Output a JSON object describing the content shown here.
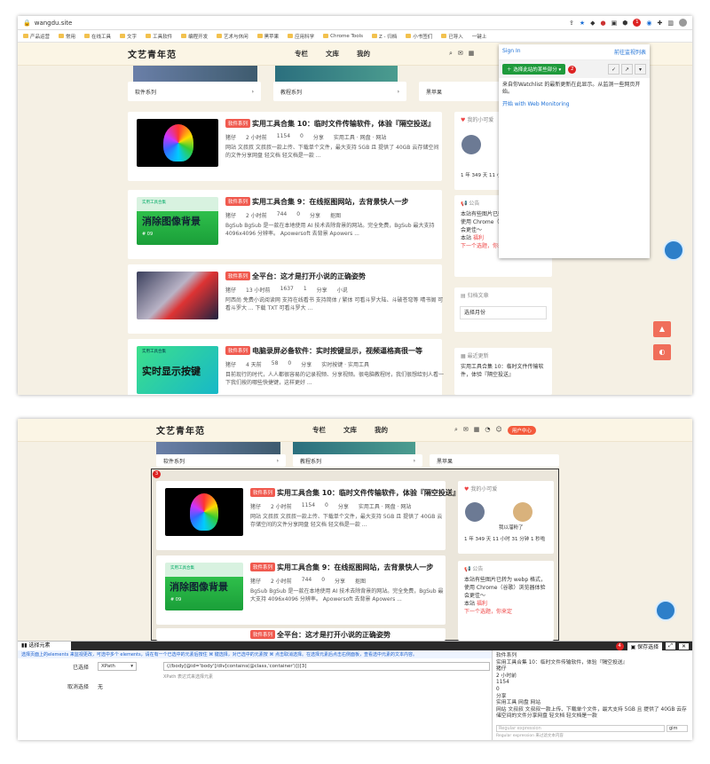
{
  "browser": {
    "url": "wangdu.site",
    "bookmarks": [
      "产品运营",
      "常用",
      "在线工具",
      "文字",
      "工具软件",
      "编程开发",
      "艺术与休闲",
      "黑苹果",
      "应用科学",
      "Chrome Tools",
      "Z - 归档",
      "小书签们",
      "已导入",
      "一键上",
      "其他书"
    ]
  },
  "site": {
    "logo": "文艺青年范",
    "nav": [
      "专栏",
      "文库",
      "我的"
    ],
    "user_center": "用户中心",
    "categories": [
      "软件系列",
      "教程系列",
      "黑苹果"
    ],
    "posts": [
      {
        "badge": "软件系列",
        "title": "实用工具合集 10：临时文件传输软件，体验『隔空投送』",
        "author": "猪仔",
        "time": "2 小时前",
        "views": "1154",
        "comments": "0",
        "share": "分享",
        "tags": "实用工具 · 网盘 · 网站",
        "excerpt": "网站 文叔叔 文叔叔一款上传、下载单个文件，最大支持 5GB 且 提供了 40GB 云存储空间的文件分享网盘 轻文档 轻文档是一款 ..."
      },
      {
        "badge": "软件系列",
        "title": "实用工具合集 9：在线抠图网站，去背景快人一步",
        "author": "猪仔",
        "time": "2 小时前",
        "views": "744",
        "comments": "0",
        "share": "分享",
        "tags": "抠图",
        "excerpt": "BgSub BgSub 是一款在本地使用 AI 技术去除背景的网站。完全免费，BgSub 最大支持 4096x4096 分辨率。 Apowersoft 去背景 Apowers ...",
        "thumb_text": "消除图像背景",
        "thumb_sub": "实用工具合集",
        "thumb_num": "# 09"
      },
      {
        "badge": "软件系列",
        "title": "全平台：这才是打开小说的正确姿势",
        "author": "猪仔",
        "time": "13 小时前",
        "views": "1637",
        "comments": "1",
        "share": "分享",
        "tags": "小说",
        "excerpt": "阿西尚 免费小说阅读网 支持在线看书 支持简体 / 繁体 可看斗罗大陆、斗破苍穹等 晴书阁 可看斗罗大 ... 下载 TXT 可看斗罗大 ..."
      },
      {
        "badge": "软件系列",
        "title": "电脑录屏必备软件：实时按键显示，视频逼格高很一等",
        "author": "猪仔",
        "time": "4 天前",
        "views": "58",
        "comments": "0",
        "share": "分享",
        "tags": "实时按键 · 实用工具",
        "excerpt": "目前现行的时代，人人都很容易的记录视频、分享视频。很电脑教程时，我们很想给别人看一下我们按的哪些快捷键，这样更好 ...",
        "thumb_text": "实时显示按键",
        "thumb_sub": "实用工具合集"
      }
    ],
    "sidebar": {
      "friend_title": "我的小可爱",
      "friend_caption": "我以溜粉了",
      "uptime": "1 年 349 天 11 小时 31 分钟 1 秒啦",
      "notice_title": "公告",
      "notice_text": "本站有些图片已转为 webp 格式，使用 Chrome（谷歌）浏览器体验会更佳～",
      "site_label": "本站",
      "site_link": "福利",
      "next_link": "下一个选题，你来定",
      "archive_title": "归档文章",
      "archive_select": "选择月份",
      "recent_title": "最近更新",
      "recent_item": "实用工具合集 10：临时文件传输软件，体验『隔空投送』"
    }
  },
  "popup": {
    "sign_in": "Sign In",
    "goto": "前往监视列表",
    "select_btn": "选择此站的某些部分",
    "badge": "2",
    "text": "来自你Watchlist 的最新更新在此显示。从监测一些网页开始。",
    "link": "开始 with Web Monitoring"
  },
  "markers": {
    "ext": "1",
    "popup_badge": "2",
    "frame": "3",
    "save": "4"
  },
  "selector": {
    "tab": "选择元素",
    "save": "保存选择",
    "tip": "选择页面上的elements 来监视更改，可选中多个 elements，请在有一个已选中的元素后按住 ⌘ 键选择，对已选中的元素按 ⌘ 点击取消选择。在选择元素后点击右侧面板，查看选中元素的文本内容。",
    "selected_label": "已选择",
    "mode": "XPath",
    "xpath": "(//body[@id='body']/div[contains(@class,'container')])[3]",
    "xpath_hint": "XPath 表达式来选择元素",
    "deselect_label": "取消选择",
    "deselect_value": "无",
    "preview": [
      "软件系列",
      "实用工具合集 10：临时文件传输软件，体验『隔空投送』",
      "猪仔",
      "2 小时前",
      "1154",
      "0",
      "分享",
      "实用工具 网盘 网站",
      "网站 文叔叔 文叔叔一款上传、下载单个文件，最大支持 5GB 且 提供了 40GB 云存储空间的文件分享网盘 轻文档 轻文档是一款"
    ],
    "regex_placeholder": "Regular expression",
    "regex_hint": "Regular expression 来过滤文本内容",
    "flags": "gim"
  }
}
